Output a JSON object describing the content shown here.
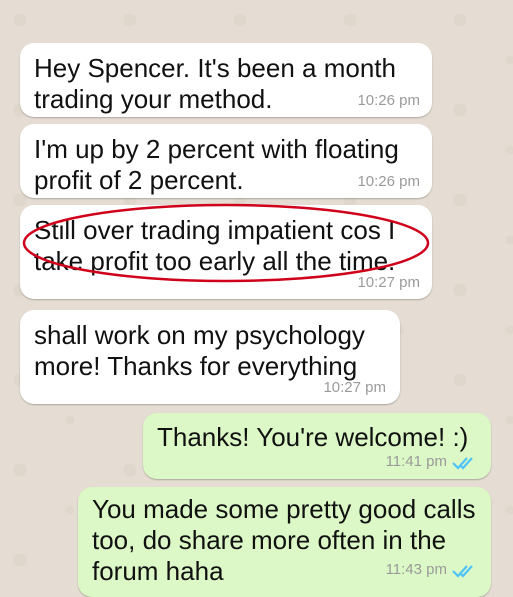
{
  "messages": [
    {
      "text": "Hey Spencer. It's been a month\ntrading your method.",
      "time": "10:26 pm"
    },
    {
      "text": "I'm up by 2 percent with floating\nprofit of 2 percent.",
      "time": "10:26 pm"
    },
    {
      "text": "Still over trading impatient cos I\ntake profit too early all the time.",
      "time": "10:27 pm"
    },
    {
      "text": "shall work on my psychology\nmore! Thanks for everything",
      "time": "10:27 pm"
    },
    {
      "text": "Thanks! You're welcome! :)",
      "time": "11:41 pm"
    },
    {
      "text": "You made some pretty good calls\ntoo, do share more often in the\nforum haha",
      "time": "11:43 pm"
    }
  ],
  "colors": {
    "incoming": "#ffffff",
    "outgoing": "#dcf8c6",
    "read_ticks": "#4fc3f7",
    "highlight_oval": "#d0021b"
  },
  "icons": {
    "read_receipt": "double-check-icon"
  }
}
